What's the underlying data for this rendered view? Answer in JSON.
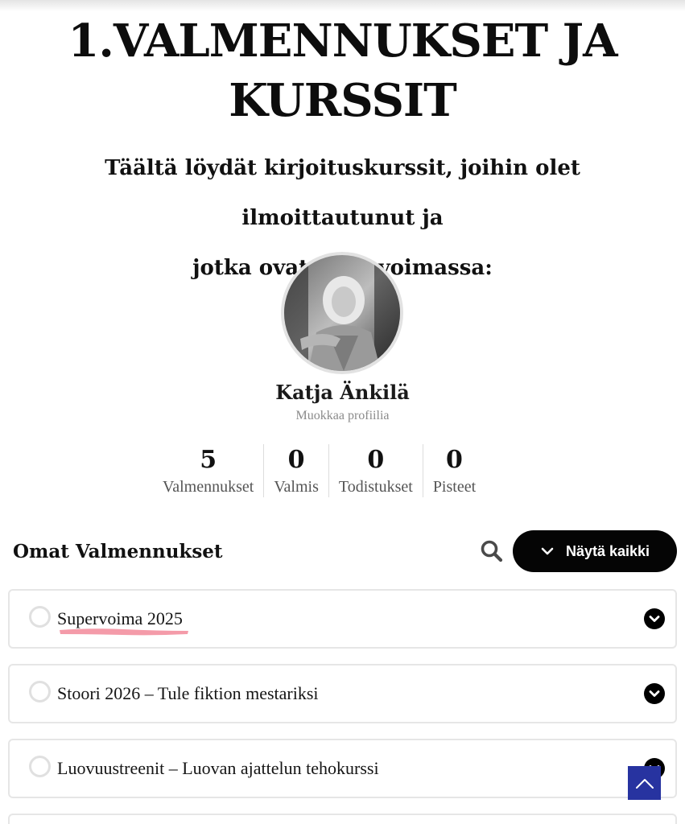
{
  "page": {
    "title_line1": "1.VALMENNUKSET JA",
    "title_line2": "KURSSIT",
    "subtitle_line1": "Täältä löydät kirjoituskurssit, joihin olet ilmoittautunut ja",
    "subtitle_line2": "jotka ovat vielä voimassa:"
  },
  "profile": {
    "name": "Katja Änkilä",
    "edit_link": "Muokkaa profiilia"
  },
  "stats": [
    {
      "value": "5",
      "label": "Valmennukset"
    },
    {
      "value": "0",
      "label": "Valmis"
    },
    {
      "value": "0",
      "label": "Todistukset"
    },
    {
      "value": "0",
      "label": "Pisteet"
    }
  ],
  "courses_section": {
    "title": "Omat Valmennukset",
    "search_icon": "search-icon",
    "show_all_label": "Näytä kaikki",
    "courses": [
      {
        "title": "Supervoima 2025"
      },
      {
        "title": "Stoori 2026 – Tule fiktion mestariksi"
      },
      {
        "title": "Luovuustreenit – Luovan ajattelun tehokurssi"
      },
      {
        "title": ""
      }
    ]
  },
  "colors": {
    "accent_button": "#050505",
    "scroll_top": "#2733a0",
    "highlight_marker": "#f28a9a"
  }
}
